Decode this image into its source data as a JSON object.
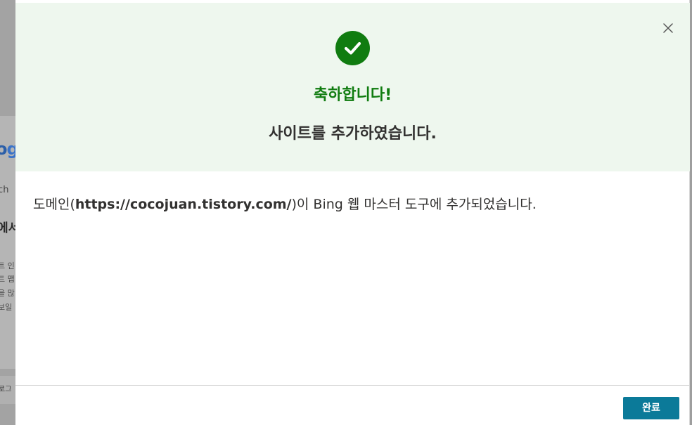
{
  "background_page": {
    "logo_fragment_a": "o",
    "logo_fragment_b": "g",
    "search_fragment": "rch",
    "heading_fragment": "에서",
    "text_fragments": [
      "트 인",
      "트 맵",
      "을 많",
      "보일"
    ],
    "footer_fragment": "로그"
  },
  "dialog": {
    "icons": {
      "success": "check-circle-icon",
      "close": "close-icon"
    },
    "congrats_title": "축하합니다!",
    "added_title": "사이트를 추가하였습니다.",
    "message": {
      "prefix": "도메인(",
      "domain": "https://cocojuan.tistory.com/",
      "suffix": ")이 Bing 웹 마스터 도구에 추가되었습니다."
    },
    "done_label": "완료"
  },
  "colors": {
    "accent_green": "#107c10",
    "banner_background": "#eef7ee",
    "primary_button": "#0b7a99",
    "text": "#323130"
  }
}
